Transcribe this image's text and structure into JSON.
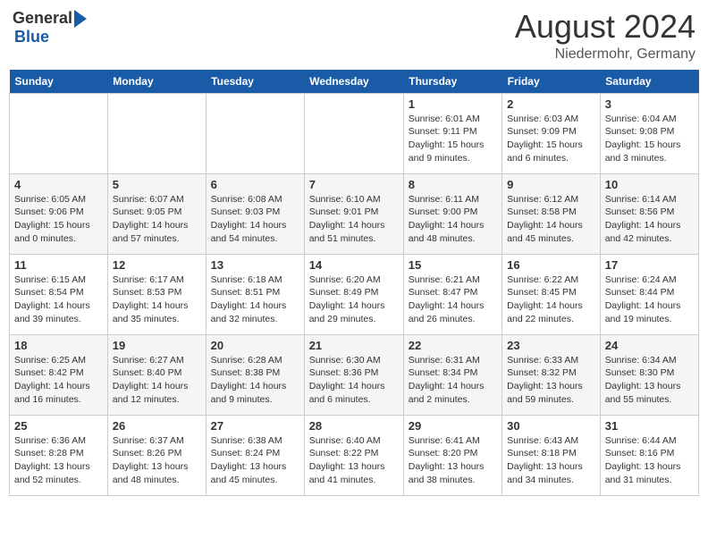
{
  "header": {
    "logo_general": "General",
    "logo_blue": "Blue",
    "month_year": "August 2024",
    "location": "Niedermohr, Germany"
  },
  "weekdays": [
    "Sunday",
    "Monday",
    "Tuesday",
    "Wednesday",
    "Thursday",
    "Friday",
    "Saturday"
  ],
  "weeks": [
    [
      {
        "day": "",
        "info": ""
      },
      {
        "day": "",
        "info": ""
      },
      {
        "day": "",
        "info": ""
      },
      {
        "day": "",
        "info": ""
      },
      {
        "day": "1",
        "info": "Sunrise: 6:01 AM\nSunset: 9:11 PM\nDaylight: 15 hours\nand 9 minutes."
      },
      {
        "day": "2",
        "info": "Sunrise: 6:03 AM\nSunset: 9:09 PM\nDaylight: 15 hours\nand 6 minutes."
      },
      {
        "day": "3",
        "info": "Sunrise: 6:04 AM\nSunset: 9:08 PM\nDaylight: 15 hours\nand 3 minutes."
      }
    ],
    [
      {
        "day": "4",
        "info": "Sunrise: 6:05 AM\nSunset: 9:06 PM\nDaylight: 15 hours\nand 0 minutes."
      },
      {
        "day": "5",
        "info": "Sunrise: 6:07 AM\nSunset: 9:05 PM\nDaylight: 14 hours\nand 57 minutes."
      },
      {
        "day": "6",
        "info": "Sunrise: 6:08 AM\nSunset: 9:03 PM\nDaylight: 14 hours\nand 54 minutes."
      },
      {
        "day": "7",
        "info": "Sunrise: 6:10 AM\nSunset: 9:01 PM\nDaylight: 14 hours\nand 51 minutes."
      },
      {
        "day": "8",
        "info": "Sunrise: 6:11 AM\nSunset: 9:00 PM\nDaylight: 14 hours\nand 48 minutes."
      },
      {
        "day": "9",
        "info": "Sunrise: 6:12 AM\nSunset: 8:58 PM\nDaylight: 14 hours\nand 45 minutes."
      },
      {
        "day": "10",
        "info": "Sunrise: 6:14 AM\nSunset: 8:56 PM\nDaylight: 14 hours\nand 42 minutes."
      }
    ],
    [
      {
        "day": "11",
        "info": "Sunrise: 6:15 AM\nSunset: 8:54 PM\nDaylight: 14 hours\nand 39 minutes."
      },
      {
        "day": "12",
        "info": "Sunrise: 6:17 AM\nSunset: 8:53 PM\nDaylight: 14 hours\nand 35 minutes."
      },
      {
        "day": "13",
        "info": "Sunrise: 6:18 AM\nSunset: 8:51 PM\nDaylight: 14 hours\nand 32 minutes."
      },
      {
        "day": "14",
        "info": "Sunrise: 6:20 AM\nSunset: 8:49 PM\nDaylight: 14 hours\nand 29 minutes."
      },
      {
        "day": "15",
        "info": "Sunrise: 6:21 AM\nSunset: 8:47 PM\nDaylight: 14 hours\nand 26 minutes."
      },
      {
        "day": "16",
        "info": "Sunrise: 6:22 AM\nSunset: 8:45 PM\nDaylight: 14 hours\nand 22 minutes."
      },
      {
        "day": "17",
        "info": "Sunrise: 6:24 AM\nSunset: 8:44 PM\nDaylight: 14 hours\nand 19 minutes."
      }
    ],
    [
      {
        "day": "18",
        "info": "Sunrise: 6:25 AM\nSunset: 8:42 PM\nDaylight: 14 hours\nand 16 minutes."
      },
      {
        "day": "19",
        "info": "Sunrise: 6:27 AM\nSunset: 8:40 PM\nDaylight: 14 hours\nand 12 minutes."
      },
      {
        "day": "20",
        "info": "Sunrise: 6:28 AM\nSunset: 8:38 PM\nDaylight: 14 hours\nand 9 minutes."
      },
      {
        "day": "21",
        "info": "Sunrise: 6:30 AM\nSunset: 8:36 PM\nDaylight: 14 hours\nand 6 minutes."
      },
      {
        "day": "22",
        "info": "Sunrise: 6:31 AM\nSunset: 8:34 PM\nDaylight: 14 hours\nand 2 minutes."
      },
      {
        "day": "23",
        "info": "Sunrise: 6:33 AM\nSunset: 8:32 PM\nDaylight: 13 hours\nand 59 minutes."
      },
      {
        "day": "24",
        "info": "Sunrise: 6:34 AM\nSunset: 8:30 PM\nDaylight: 13 hours\nand 55 minutes."
      }
    ],
    [
      {
        "day": "25",
        "info": "Sunrise: 6:36 AM\nSunset: 8:28 PM\nDaylight: 13 hours\nand 52 minutes."
      },
      {
        "day": "26",
        "info": "Sunrise: 6:37 AM\nSunset: 8:26 PM\nDaylight: 13 hours\nand 48 minutes."
      },
      {
        "day": "27",
        "info": "Sunrise: 6:38 AM\nSunset: 8:24 PM\nDaylight: 13 hours\nand 45 minutes."
      },
      {
        "day": "28",
        "info": "Sunrise: 6:40 AM\nSunset: 8:22 PM\nDaylight: 13 hours\nand 41 minutes."
      },
      {
        "day": "29",
        "info": "Sunrise: 6:41 AM\nSunset: 8:20 PM\nDaylight: 13 hours\nand 38 minutes."
      },
      {
        "day": "30",
        "info": "Sunrise: 6:43 AM\nSunset: 8:18 PM\nDaylight: 13 hours\nand 34 minutes."
      },
      {
        "day": "31",
        "info": "Sunrise: 6:44 AM\nSunset: 8:16 PM\nDaylight: 13 hours\nand 31 minutes."
      }
    ]
  ]
}
